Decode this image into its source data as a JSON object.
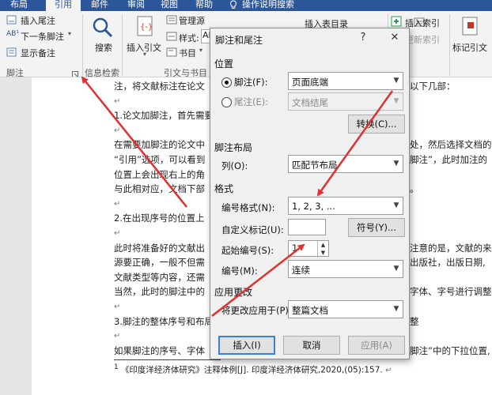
{
  "menu": {
    "tabs": [
      {
        "label": "布局"
      },
      {
        "label": "引用",
        "active": true
      },
      {
        "label": "邮件"
      },
      {
        "label": "审阅"
      },
      {
        "label": "视图"
      },
      {
        "label": "帮助"
      }
    ],
    "tell_me": "操作说明搜索"
  },
  "ribbon": {
    "footnote_group": {
      "insert_endnote": "插入尾注",
      "next_footnote": "下一条脚注",
      "show_notes": "显示备注",
      "label": "脚注"
    },
    "research_group": {
      "search": "搜索",
      "label": "信息检索"
    },
    "citation_group": {
      "insert_citation": "插入引文",
      "manage_sources": "管理源",
      "style_label": "样式:",
      "style_value": "AP",
      "bibliography": "书目",
      "label": "引文与书目"
    },
    "captions_group": {
      "insert_table_of_figures": "插入表目录"
    },
    "index_group": {
      "insert_index": "插入索引",
      "update_index": "更新索引"
    },
    "citation_mark": "标记引文"
  },
  "document": {
    "left_lines": [
      "注，将文献标注在论文",
      "",
      "1.论文加脚注，首先需要",
      "",
      "在需要加脚注的论文中",
      "“引用”选项，可以看到",
      "位置上会出现右上的角",
      "与此相对应，文档下部",
      "",
      "2.在出现序号的位置上",
      "",
      "此时将准备好的文献出",
      "源要正确，一般不但需",
      "文献类型等内容，还需",
      "当然，此时的脚注中的",
      "",
      "3.脚注的整体序号和布局",
      "",
      "如果脚注的序号、字体"
    ],
    "right_lines": [
      {
        "text": "以下几部：",
        "row": 0
      },
      {
        "text": "处，然后选择文档的",
        "row": 4
      },
      {
        "text": "脚注”，此时加注的",
        "row": 5
      },
      {
        "text": "。",
        "row": 7
      },
      {
        "text": "注意的是，文献的来",
        "row": 11
      },
      {
        "text": "出版社，出版日期,",
        "row": 12
      },
      {
        "text": "字体、字号进行调整。",
        "row": 14
      },
      {
        "text": "整",
        "row": 16
      },
      {
        "text": "脚注”中的下拉位置,",
        "row": 18
      }
    ],
    "footnote_text": "《印度洋经济体研究》注释体例[J]. 印度洋经济体研究,2020,(05):157.",
    "footnote_number": "1"
  },
  "dialog": {
    "title": "脚注和尾注",
    "help": "?",
    "close": "✕",
    "position": {
      "section": "位置",
      "footnote_label": "脚注(F):",
      "footnote_value": "页面底端",
      "endnote_label": "尾注(E):",
      "endnote_value": "文档结尾",
      "convert_button": "转换(C)..."
    },
    "layout": {
      "section": "脚注布局",
      "columns_label": "列(O):",
      "columns_value": "匹配节布局"
    },
    "format": {
      "section": "格式",
      "number_format_label": "编号格式(N):",
      "number_format_value": "1, 2, 3, ...",
      "custom_mark_label": "自定义标记(U):",
      "custom_mark_value": "",
      "symbol_button": "符号(Y)...",
      "start_at_label": "起始编号(S):",
      "start_at_value": "1",
      "numbering_label": "编号(M):",
      "numbering_value": "连续"
    },
    "apply": {
      "section": "应用更改",
      "apply_to_label": "将更改应用于(P):",
      "apply_to_value": "整篇文档"
    },
    "buttons": {
      "insert": "插入(I)",
      "cancel": "取消",
      "apply": "应用(A)"
    }
  },
  "colors": {
    "menubar": "#2b579a",
    "annotation_arrow": "#e03030",
    "focus_border": "#3c7fd4"
  }
}
